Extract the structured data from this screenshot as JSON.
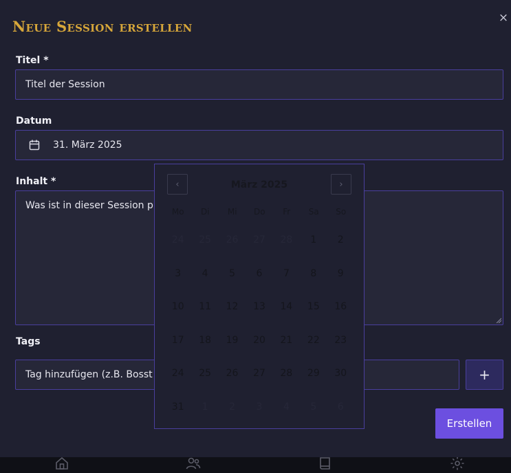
{
  "modal": {
    "title": "Neue Session erstellen",
    "close_symbol": "×"
  },
  "form": {
    "title_label": "Titel *",
    "title_placeholder": "Titel der Session",
    "date_label": "Datum",
    "date_value": "31. März 2025",
    "content_label": "Inhalt *",
    "content_placeholder": "Was ist in dieser Session p",
    "tags_label": "Tags",
    "tags_placeholder": "Tag hinzufügen (z.B. Bosst",
    "add_tag_symbol": "+",
    "submit_label": "Erstellen"
  },
  "datepicker": {
    "month_label": "März 2025",
    "prev_symbol": "‹",
    "next_symbol": "›",
    "weekdays": [
      "Mo",
      "Di",
      "Mi",
      "Do",
      "Fr",
      "Sa",
      "So"
    ],
    "weeks": [
      [
        {
          "d": "24",
          "m": true
        },
        {
          "d": "25",
          "m": true
        },
        {
          "d": "26",
          "m": true
        },
        {
          "d": "27",
          "m": true
        },
        {
          "d": "28",
          "m": true
        },
        {
          "d": "1",
          "m": false
        },
        {
          "d": "2",
          "m": false
        }
      ],
      [
        {
          "d": "3",
          "m": false
        },
        {
          "d": "4",
          "m": false
        },
        {
          "d": "5",
          "m": false
        },
        {
          "d": "6",
          "m": false
        },
        {
          "d": "7",
          "m": false
        },
        {
          "d": "8",
          "m": false
        },
        {
          "d": "9",
          "m": false
        }
      ],
      [
        {
          "d": "10",
          "m": false
        },
        {
          "d": "11",
          "m": false
        },
        {
          "d": "12",
          "m": false
        },
        {
          "d": "13",
          "m": false
        },
        {
          "d": "14",
          "m": false
        },
        {
          "d": "15",
          "m": false
        },
        {
          "d": "16",
          "m": false
        }
      ],
      [
        {
          "d": "17",
          "m": false
        },
        {
          "d": "18",
          "m": false
        },
        {
          "d": "19",
          "m": false
        },
        {
          "d": "20",
          "m": false
        },
        {
          "d": "21",
          "m": false
        },
        {
          "d": "22",
          "m": false
        },
        {
          "d": "23",
          "m": false
        }
      ],
      [
        {
          "d": "24",
          "m": false
        },
        {
          "d": "25",
          "m": false
        },
        {
          "d": "26",
          "m": false
        },
        {
          "d": "27",
          "m": false
        },
        {
          "d": "28",
          "m": false
        },
        {
          "d": "29",
          "m": false
        },
        {
          "d": "30",
          "m": false
        }
      ],
      [
        {
          "d": "31",
          "m": false
        },
        {
          "d": "1",
          "m": true
        },
        {
          "d": "2",
          "m": true
        },
        {
          "d": "3",
          "m": true
        },
        {
          "d": "4",
          "m": true
        },
        {
          "d": "5",
          "m": true
        },
        {
          "d": "6",
          "m": true
        }
      ]
    ]
  },
  "bottom_nav": {
    "icons": [
      "home-icon",
      "users-icon",
      "book-icon",
      "settings-icon"
    ]
  },
  "colors": {
    "accent": "#6c4fe0",
    "title_gold": "#d6a63a",
    "field_border": "#4a3f9e",
    "background": "#1f2030"
  }
}
